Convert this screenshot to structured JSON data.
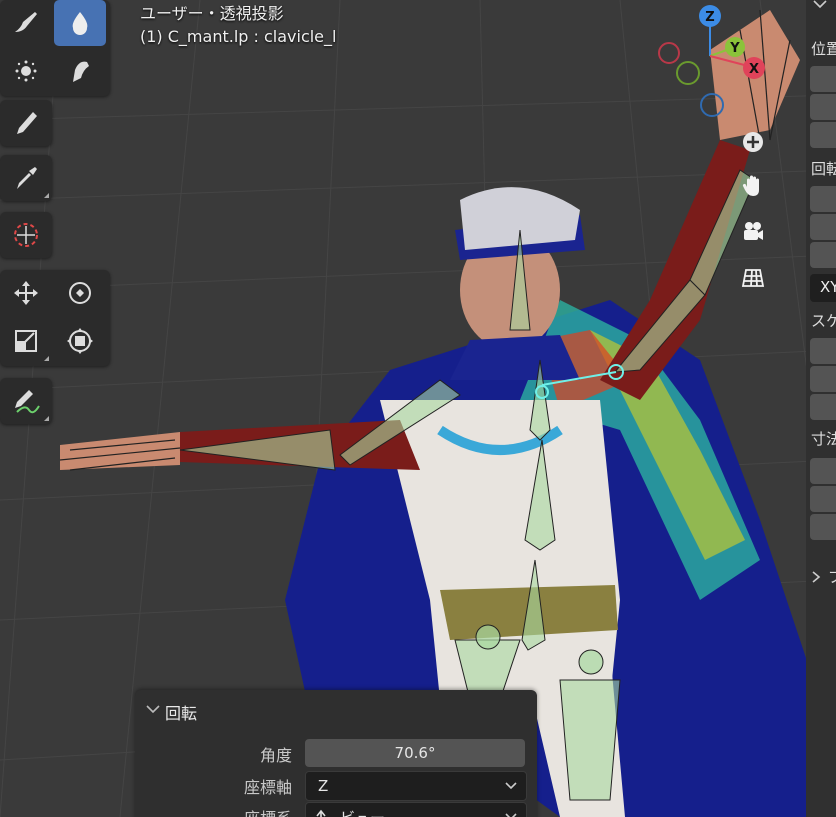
{
  "viewport": {
    "view_name": "ユーザー・透視投影",
    "active_object": "(1) C_mant.lp : clavicle_l"
  },
  "toolbar": {
    "tools": [
      {
        "name": "draw-brush",
        "active": false
      },
      {
        "name": "smear",
        "active": true
      },
      {
        "name": "soften",
        "active": false
      },
      {
        "name": "gradient",
        "active": false
      },
      {
        "name": "sample",
        "active": false
      },
      {
        "name": "cursor",
        "active": false
      },
      {
        "name": "move",
        "active": false
      },
      {
        "name": "rotate",
        "active": false
      },
      {
        "name": "scale",
        "active": false
      },
      {
        "name": "transform",
        "active": false
      },
      {
        "name": "annotate",
        "active": false
      }
    ]
  },
  "gizmo": {
    "axes": [
      "Z",
      "Y",
      "X"
    ],
    "colors": {
      "x": "#e0435a",
      "y": "#8bc33a",
      "z": "#3c8ce6"
    }
  },
  "navigation": {
    "buttons": [
      "zoom-icon",
      "hand-icon",
      "camera-icon",
      "grid-icon"
    ]
  },
  "sidebar": {
    "labels": [
      "位置",
      "回転",
      "XY",
      "スケ",
      "寸法",
      "プ"
    ]
  },
  "operator_panel": {
    "title": "回転",
    "angle_label": "角度",
    "angle_value": "70.6°",
    "axis_label": "座標軸",
    "axis_value": "Z",
    "orient_label": "座標系",
    "orient_value": "ビュー"
  },
  "colors": {
    "accent": "#4772b3",
    "bg": "#3a3a3a",
    "panel": "#2f2f2f"
  }
}
